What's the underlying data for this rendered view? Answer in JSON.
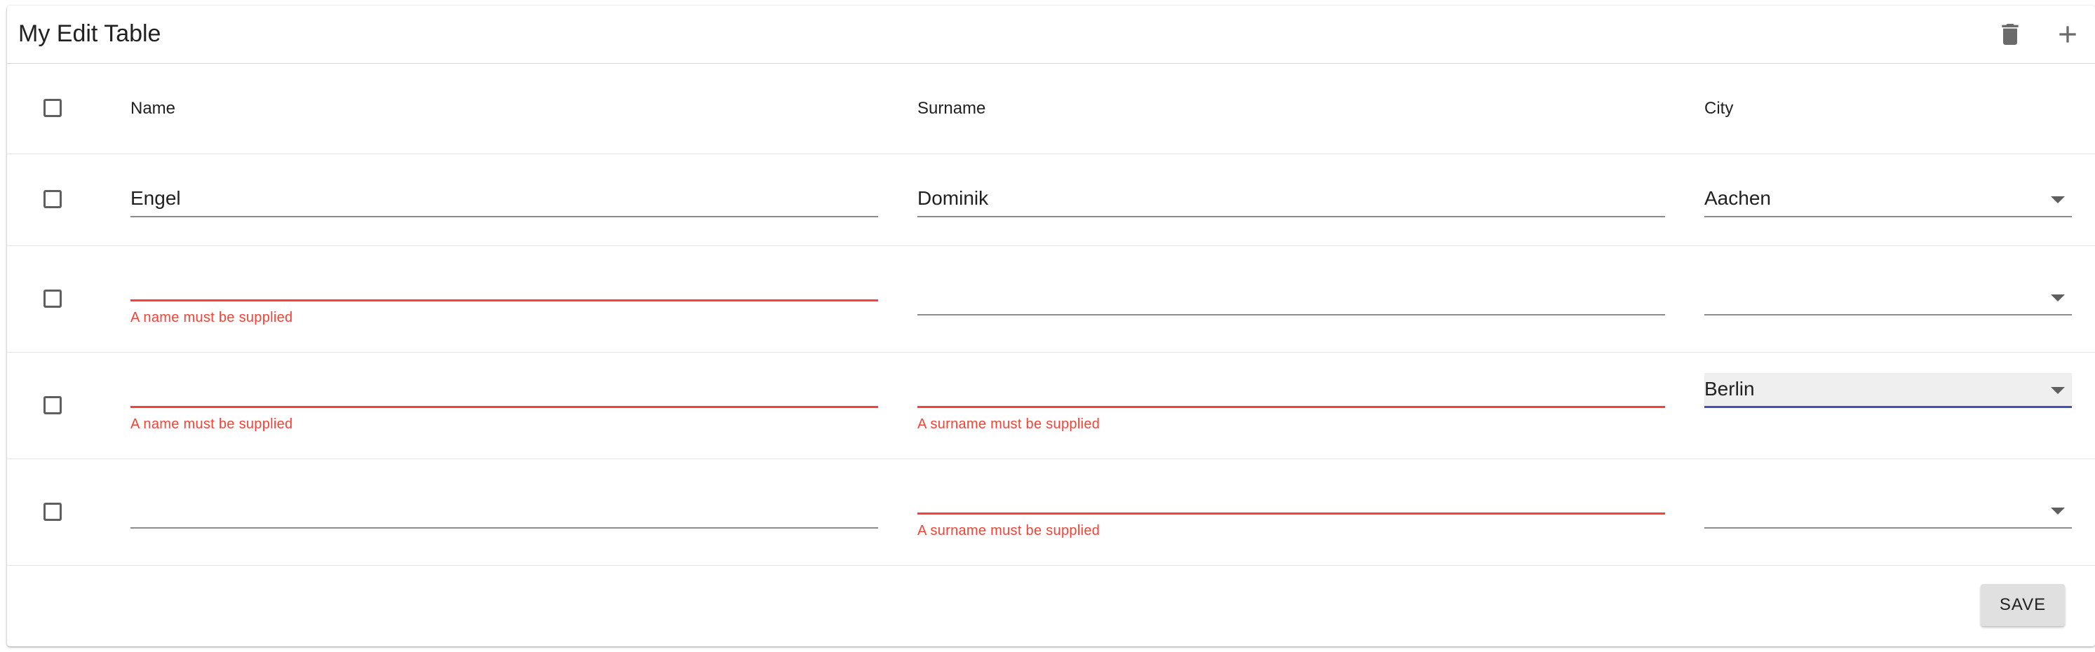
{
  "toolbar": {
    "title": "My Edit Table",
    "icons": {
      "delete": "trash-icon",
      "add": "plus-icon"
    }
  },
  "columns": {
    "name": "Name",
    "surname": "Surname",
    "city": "City"
  },
  "rows": [
    {
      "name": "Engel",
      "surname": "Dominik",
      "city": "Aachen",
      "name_error": "",
      "surname_error": ""
    },
    {
      "name": "",
      "surname": "",
      "city": "",
      "name_error": "A name must be supplied",
      "surname_error": ""
    },
    {
      "name": "",
      "surname": "",
      "city": "Berlin",
      "name_error": "A name must be supplied",
      "surname_error": "A surname must be supplied"
    },
    {
      "name": "",
      "surname": "",
      "city": "",
      "name_error": "",
      "surname_error": "A surname must be supplied"
    }
  ],
  "actions": {
    "save_label": "SAVE"
  },
  "colors": {
    "error": "#f44336",
    "focus": "#3f51b5"
  }
}
